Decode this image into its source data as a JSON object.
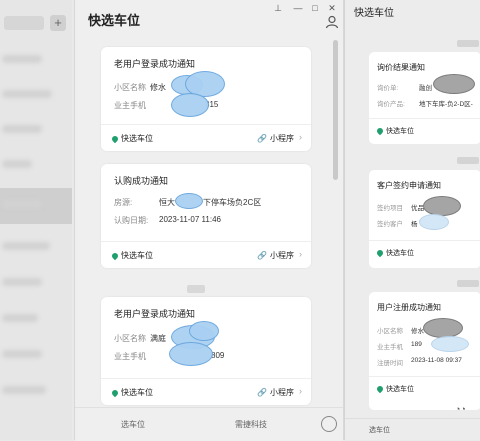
{
  "main": {
    "title": "快选车位",
    "cards": [
      {
        "title": "老用户登录成功通知",
        "fields": [
          {
            "label": "小区名称",
            "value": "修水"
          },
          {
            "label": "业主手机",
            "value": "315"
          }
        ],
        "footer_left": "快选车位",
        "footer_right": "小程序"
      },
      {
        "title": "认购成功通知",
        "fields": [
          {
            "label": "房源:",
            "value": "恒大",
            "value2": "下停车场负2C区"
          },
          {
            "label": "认购日期:",
            "value": "2023-11-07 11:46"
          }
        ],
        "footer_left": "快选车位",
        "footer_right": "小程序"
      },
      {
        "title": "老用户登录成功通知",
        "fields": [
          {
            "label": "小区名称",
            "value": "满庭"
          },
          {
            "label": "业主手机",
            "value": "809"
          }
        ],
        "footer_left": "快选车位",
        "footer_right": "小程序"
      }
    ],
    "bottombar": {
      "left": "选车位",
      "right": "需捷科技"
    }
  },
  "right": {
    "title": "快选车位",
    "cards": [
      {
        "title": "询价结果通知",
        "fields": [
          {
            "label": "询价单:",
            "value": "融创"
          },
          {
            "label": "询价产品:",
            "value": "地下车库-负2-D区-"
          }
        ],
        "footer": "快选车位"
      },
      {
        "title": "客户签约申请通知",
        "fields": [
          {
            "label": "签约项目",
            "value": "优品"
          },
          {
            "label": "签约客户",
            "value": "杨"
          }
        ],
        "footer": "快选车位"
      },
      {
        "title": "用户注册成功通知",
        "fields": [
          {
            "label": "小区名称",
            "value": "修水"
          },
          {
            "label": "业主手机",
            "value": "189"
          },
          {
            "label": "注册时间",
            "value": "2023-11-08 09:37"
          }
        ],
        "footer": "快选车位"
      }
    ],
    "bottom": "选车位"
  },
  "left_list": {
    "plus": "+"
  },
  "colors": {
    "pin": "#1f9e6e",
    "link": "#6b6bd6",
    "cloud": "#a9d0f2"
  }
}
